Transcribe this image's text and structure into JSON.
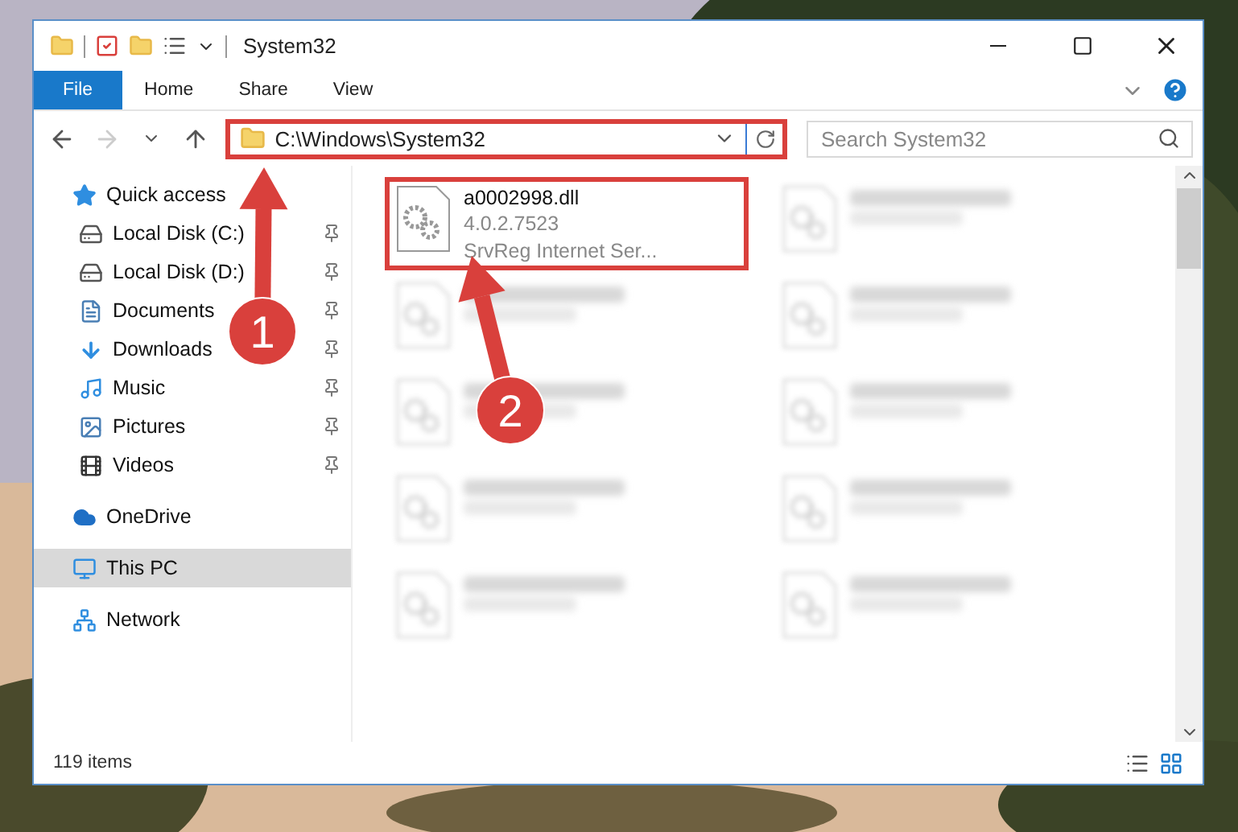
{
  "window": {
    "title": "System32"
  },
  "ribbon": {
    "tabs": [
      {
        "label": "File",
        "kind": "file"
      },
      {
        "label": "Home",
        "kind": "tab"
      },
      {
        "label": "Share",
        "kind": "tab"
      },
      {
        "label": "View",
        "kind": "tab"
      }
    ]
  },
  "navigation": [
    {
      "kind": "back",
      "disabled": false
    },
    {
      "kind": "forward",
      "disabled": true
    },
    {
      "kind": "recent",
      "disabled": false
    },
    {
      "kind": "up",
      "disabled": false
    }
  ],
  "address_bar": {
    "path": "C:\\Windows\\System32",
    "highlighted": true
  },
  "search": {
    "placeholder": "Search System32"
  },
  "sidebar": {
    "items": [
      {
        "label": "Quick access",
        "kind": "quick-access",
        "selected": false,
        "children": [
          {
            "label": "Local Disk (C:)",
            "kind": "disk-c",
            "pinned": true
          },
          {
            "label": "Local Disk (D:)",
            "kind": "disk",
            "pinned": true
          },
          {
            "label": "Documents",
            "kind": "documents",
            "pinned": true
          },
          {
            "label": "Downloads",
            "kind": "downloads",
            "pinned": true
          },
          {
            "label": "Music",
            "kind": "music",
            "pinned": true
          },
          {
            "label": "Pictures",
            "kind": "pictures",
            "pinned": true
          },
          {
            "label": "Videos",
            "kind": "videos",
            "pinned": true
          }
        ]
      },
      {
        "label": "OneDrive",
        "kind": "cloud",
        "selected": false
      },
      {
        "label": "This PC",
        "kind": "pc",
        "selected": true
      },
      {
        "label": "Network",
        "kind": "network",
        "selected": false
      }
    ]
  },
  "files": [
    {
      "name": "a0002998.dll",
      "details": [
        "4.0.2.7523",
        "SrvReg Internet Ser..."
      ],
      "blurred": false,
      "highlighted": true
    },
    {
      "blurred": true,
      "highlighted": false
    },
    {
      "blurred": true,
      "highlighted": false
    },
    {
      "blurred": true,
      "highlighted": false
    },
    {
      "blurred": true,
      "highlighted": false
    },
    {
      "blurred": true,
      "highlighted": false
    },
    {
      "blurred": true,
      "highlighted": false
    },
    {
      "blurred": true,
      "highlighted": false
    },
    {
      "blurred": true,
      "highlighted": false
    },
    {
      "blurred": true,
      "highlighted": false
    }
  ],
  "annotations": [
    {
      "label": "1"
    },
    {
      "label": "2"
    }
  ],
  "status_bar": {
    "item_count": "119 items"
  }
}
